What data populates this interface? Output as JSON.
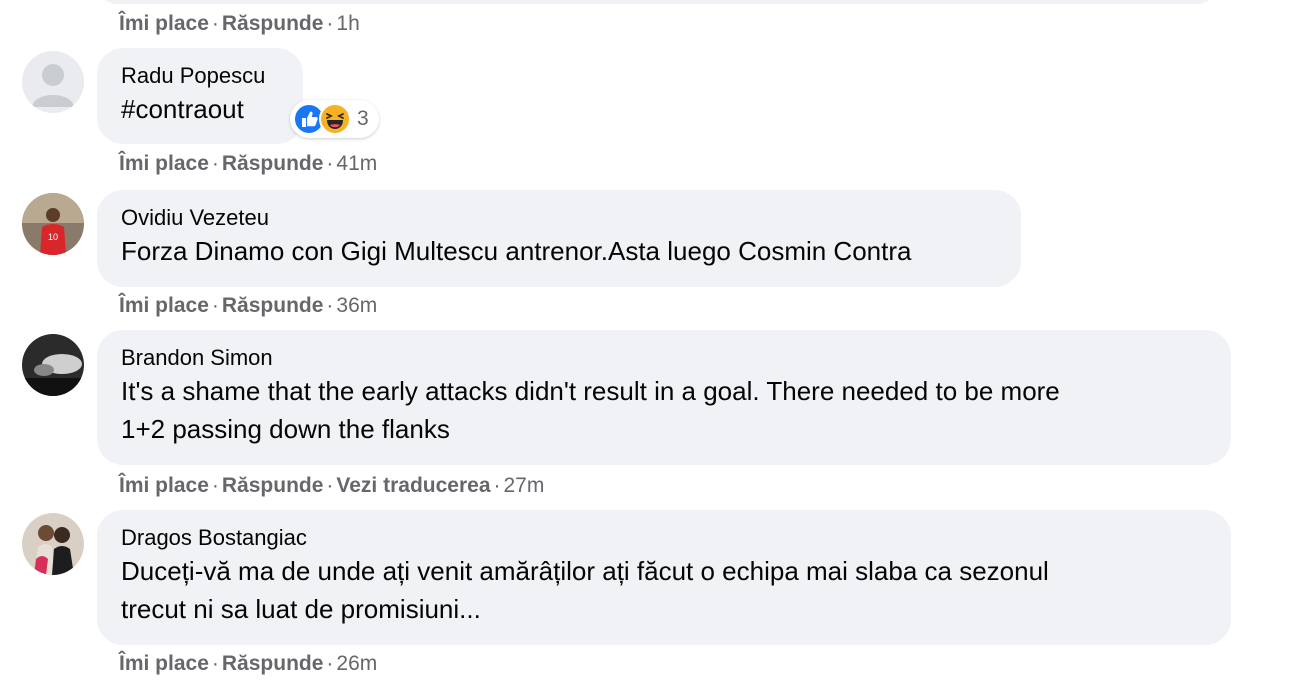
{
  "labels": {
    "like": "Îmi place",
    "reply": "Răspunde",
    "translate": "Vezi traducerea",
    "sep": "·"
  },
  "previous_comment": {
    "time": "1h"
  },
  "comments": [
    {
      "author": "Radu Popescu",
      "text": "#contraout",
      "time": "41m",
      "avatar": "default-avatar-icon",
      "reactions": {
        "icons": [
          "like-icon",
          "haha-icon"
        ],
        "count": "3"
      }
    },
    {
      "author": "Ovidiu Vezeteu",
      "text": "Forza Dinamo con Gigi Multescu antrenor.Asta luego Cosmin Contra",
      "time": "36m",
      "avatar": "user-photo"
    },
    {
      "author": "Brandon Simon",
      "text_lines": [
        "It's a shame that the early attacks didn't result in a goal. There needed to be more",
        "1+2 passing down the flanks"
      ],
      "time": "27m",
      "avatar": "user-photo"
    },
    {
      "author": "Dragos Bostangiac",
      "text_lines": [
        "Duceți-vă ma de unde ați venit amărâților ați făcut o echipa mai slaba ca sezonul",
        "trecut ni sa luat de promisiuni..."
      ],
      "time": "26m",
      "avatar": "user-photo"
    }
  ],
  "colors": {
    "bubble": "#f0f2f5",
    "meta": "#65676b",
    "like_blue": "#1877f2",
    "haha_yellow": "#f7b125"
  }
}
